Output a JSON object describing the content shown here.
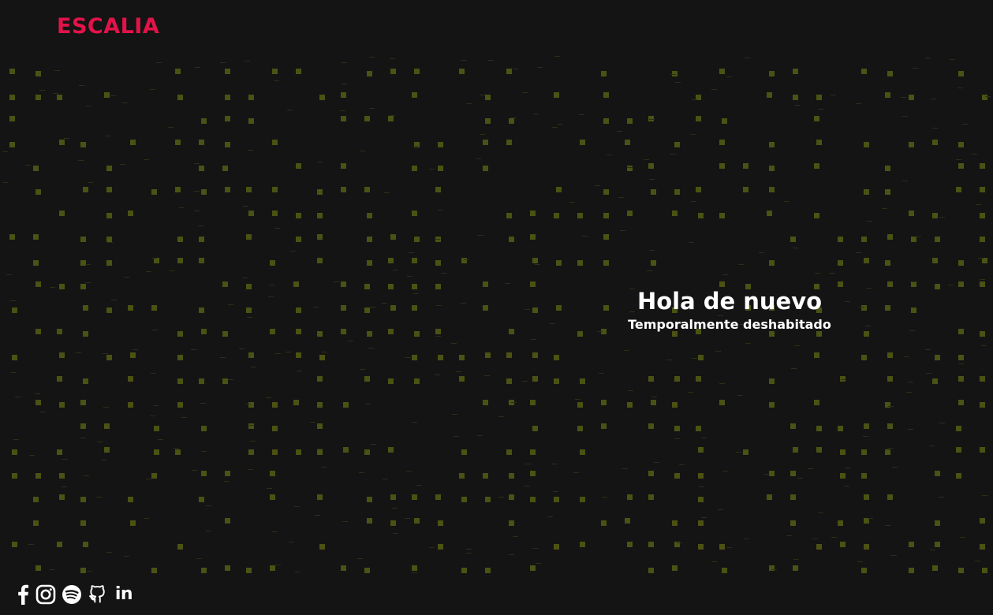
{
  "brand": {
    "name": "ESCALIA",
    "color": "#e3134a"
  },
  "hero": {
    "title": "Hola de nuevo",
    "subtitle": "Temporalmente deshabitado"
  },
  "background": {
    "color": "#141414",
    "dot_color": "#4b5214",
    "dash_color": "#2c2f18"
  },
  "socials": [
    {
      "icon": "facebook-icon"
    },
    {
      "icon": "instagram-icon"
    },
    {
      "icon": "spotify-icon"
    },
    {
      "icon": "github-icon"
    },
    {
      "icon": "linkedin-icon",
      "text": "in"
    }
  ]
}
